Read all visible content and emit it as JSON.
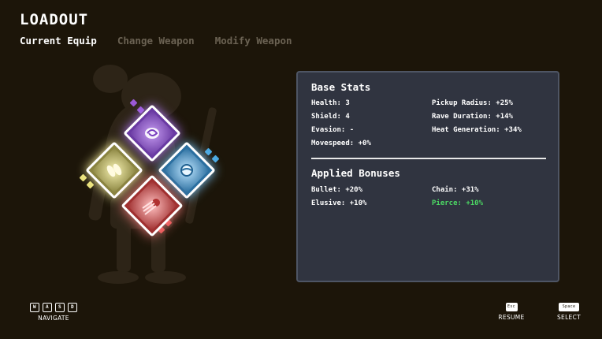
{
  "header": {
    "title": "LOADOUT"
  },
  "tabs": [
    {
      "label": "Current Equip",
      "active": true
    },
    {
      "label": "Change Weapon",
      "active": false
    },
    {
      "label": "Modify Weapon",
      "active": false
    }
  ],
  "weapons": [
    {
      "name": "purple-weapon",
      "color": "#9b59d6"
    },
    {
      "name": "yellow-weapon",
      "color": "#e8e07a"
    },
    {
      "name": "blue-weapon",
      "color": "#4aa8e0"
    },
    {
      "name": "red-weapon",
      "color": "#e05050"
    }
  ],
  "base_stats": {
    "title": "Base Stats",
    "left": [
      "Health: 3",
      "Shield: 4",
      "Evasion: -",
      "Movespeed: +0%"
    ],
    "right": [
      "Pickup Radius: +25%",
      "Rave Duration: +14%",
      "Heat Generation: +34%"
    ]
  },
  "bonuses": {
    "title": "Applied Bonuses",
    "left": [
      "Bullet: +20%",
      "Elusive: +10%"
    ],
    "right": [
      "Chain: +31%",
      "Pierce: +10%"
    ],
    "highlight_color": "#4cd964"
  },
  "controls": {
    "navigate": {
      "label": "NAVIGATE",
      "keys": [
        "W",
        "A",
        "S",
        "D"
      ]
    },
    "resume": {
      "label": "RESUME",
      "key": "Esc"
    },
    "select": {
      "label": "SELECT",
      "key": "Space"
    }
  }
}
